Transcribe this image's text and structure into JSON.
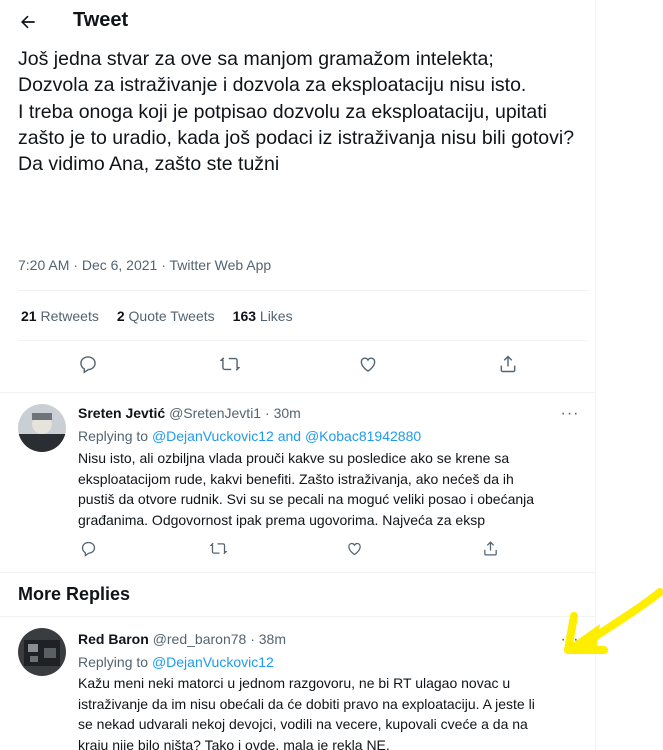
{
  "header": {
    "title": "Tweet"
  },
  "tweet": {
    "text": "Još jedna stvar za ove sa manjom gramažom intelekta;\nDozvola za istraživanje i dozvola za eksploataciju nisu isto.\nI treba onoga koji je potpisao dozvolu za eksploataciju, upitati zašto je to uradio, kada još podaci iz istraživanja nisu bili gotovi?\nDa vidimo Ana, zašto ste tužni",
    "time": "7:20 AM",
    "date": "Dec 6, 2021",
    "source": "Twitter Web App",
    "retweets_count": "21",
    "retweets_label": "Retweets",
    "quotes_count": "2",
    "quotes_label": "Quote Tweets",
    "likes_count": "163",
    "likes_label": "Likes"
  },
  "replies": [
    {
      "name": "Sreten Jevtić",
      "handle": "@SretenJevti1",
      "time": "30m",
      "replying_label": "Replying to",
      "replying_to": "@DejanVuckovic12 and @Kobac81942880",
      "text": "Nisu isto, ali ozbiljna vlada prouči kakve su posledice ako se krene sa\neksploatacijom rude, kakvi benefiti. Zašto istraživanja, ako nećeš da ih\npustiš da otvore rudnik. Svi su se pecali na moguć veliki posao i obećanja\ngrađanima. Odgovornost ipak prema ugovorima. Najveća za eksp"
    }
  ],
  "more_replies": {
    "title": "More Replies",
    "items": [
      {
        "name": "Red Baron",
        "handle": "@red_baron78",
        "time": "38m",
        "replying_label": "Replying to",
        "replying_to": "@DejanVuckovic12",
        "text": "Kažu meni neki matorci u jednom razgovoru, ne bi RT ulagao novac u\nistraživanje da im nisu obećali da će dobiti pravo na exploataciju. A jeste li\nse nekad udvarali nekoj devojci, vodili na vecere, kupovali cveće a da na\nkraju nije bilo ništa? Tako i ovde, mala je rekla NE."
      }
    ]
  },
  "icons": {
    "back": "arrow-left-icon",
    "reply": "reply-icon",
    "retweet": "retweet-icon",
    "like": "heart-icon",
    "share": "share-icon",
    "more": "more-icon"
  },
  "colors": {
    "link": "#1d9bf0",
    "muted": "#536471",
    "text": "#0f1419",
    "annotation": "#ffee00"
  }
}
